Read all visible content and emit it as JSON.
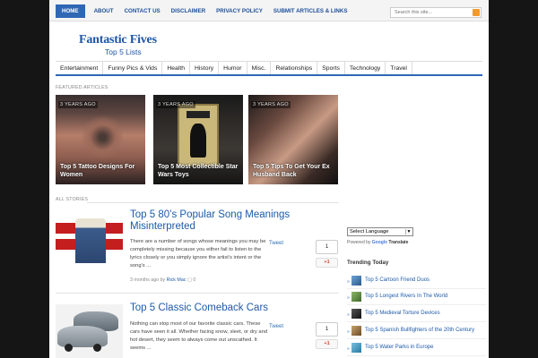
{
  "nav": {
    "items": [
      "HOME",
      "ABOUT",
      "CONTACT US",
      "DISCLAIMER",
      "PRIVACY POLICY",
      "SUBMIT ARTICLES & LINKS"
    ],
    "search_placeholder": "Search this site..."
  },
  "site": {
    "title": "Fantastic Fives",
    "subtitle": "Top 5 Lists"
  },
  "categories": [
    "Entertainment",
    "Funny Pics & Vids",
    "Health",
    "History",
    "Humor",
    "Misc.",
    "Relationships",
    "Sports",
    "Technology",
    "Travel"
  ],
  "featured": {
    "label": "FEATURED ARTICLES",
    "items": [
      {
        "age": "3 YEARS AGO",
        "title": "Top 5 Tattoo Designs For Women"
      },
      {
        "age": "3 YEARS AGO",
        "title": "Top 5 Most Collectible Star Wars Toys"
      },
      {
        "age": "3 YEARS AGO",
        "title": "Top 5 Tips To Get Your Ex Husband Back"
      }
    ]
  },
  "stories": {
    "label": "ALL STORIES",
    "items": [
      {
        "title": "Top 5 80’s Popular Song Meanings Misinterpreted",
        "excerpt": "There are a number of songs whose meanings you may be completely missing because you either fail to listen to the lyrics closely or you simply ignore the artist’s intent or the song’s ...",
        "meta_time": "3 months ago by",
        "author": "Rick Mac",
        "comments": "0",
        "tweet": "Tweet",
        "likes": "1",
        "gplus": "+1"
      },
      {
        "title": "Top 5 Classic Comeback Cars",
        "excerpt": "Nothing can stop most of our favorite classic cars. These cars have seen it all. Whether facing snow, sleet, or dry and hot desert, they seem to always come out unscathed. It seems ...",
        "tweet": "Tweet",
        "likes": "1",
        "gplus": "+1"
      }
    ]
  },
  "sidebar": {
    "language": "Select Language",
    "powered_by": "Powered by",
    "google": "Google",
    "translate": "Translate",
    "trending_heading": "Trending Today",
    "trending": [
      "Top 5 Cartoon Friend Duos",
      "Top 5 Longest Rivers In The World",
      "Top 5 Medieval Torture Devices",
      "Top 5 Spanish Bullfighters of the 20th Century",
      "Top 5 Water Parks in Europe"
    ]
  },
  "colors": {
    "accent": "#2f67b5",
    "link": "#1e5aa8",
    "search_button": "#f29a2e"
  }
}
